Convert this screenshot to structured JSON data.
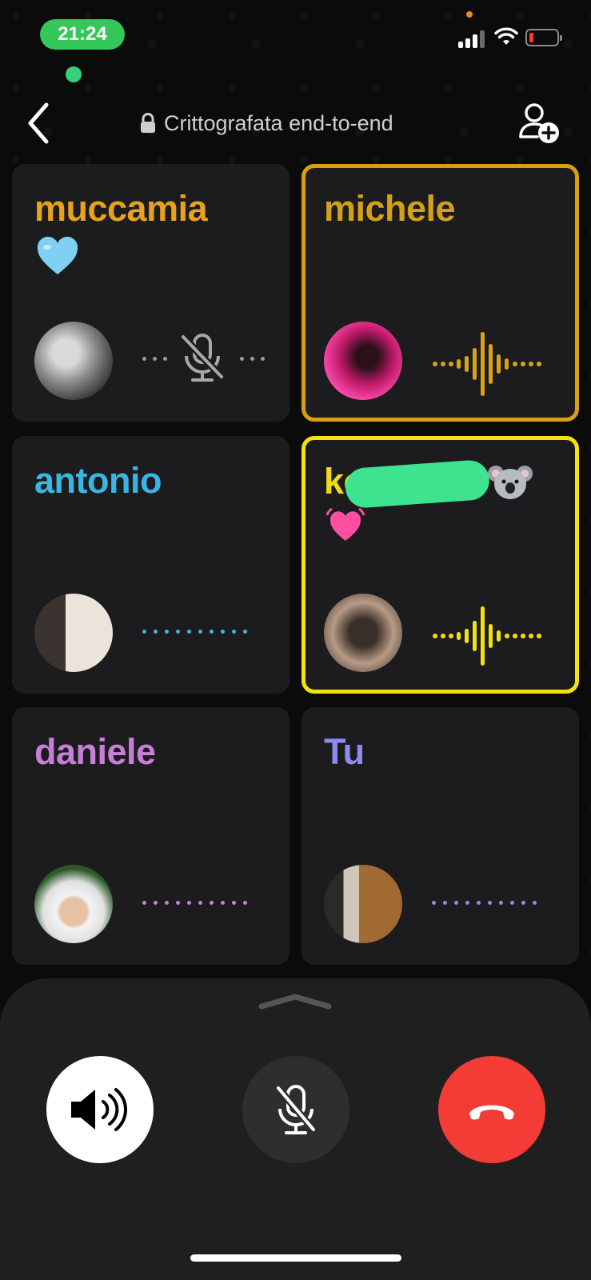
{
  "status_bar": {
    "time": "21:24"
  },
  "header": {
    "encryption_text": "Crittografata end-to-end"
  },
  "participants": [
    {
      "name": "muccamia",
      "emoji_line2": "🩵",
      "name_color": "#e8a21b",
      "status": "muted",
      "dot_color": "#9a9a9a"
    },
    {
      "name": "michele",
      "name_color": "#d4a017",
      "status": "speaking",
      "wave_color": "#d8a315"
    },
    {
      "name": "ko…t🐨",
      "emoji_line2": "💓",
      "name_color": "#f0dc14",
      "status": "speaking",
      "wave_color": "#f5e10d"
    },
    {
      "name": "antonio",
      "name_color": "#39b7e4",
      "status": "idle",
      "dot_color": "#39b7e4"
    },
    {
      "name": "daniele",
      "name_color": "#c77ed6",
      "status": "idle",
      "dot_color": "#c77ed6"
    },
    {
      "name": "Tu",
      "name_color": "#8c8cf0",
      "status": "idle",
      "dot_color": "#8c8cf0"
    }
  ],
  "controls": {
    "speaker_bg": "#ffffff",
    "mute_bg": "#2e2e2e",
    "end_call_bg": "#f23c35"
  }
}
